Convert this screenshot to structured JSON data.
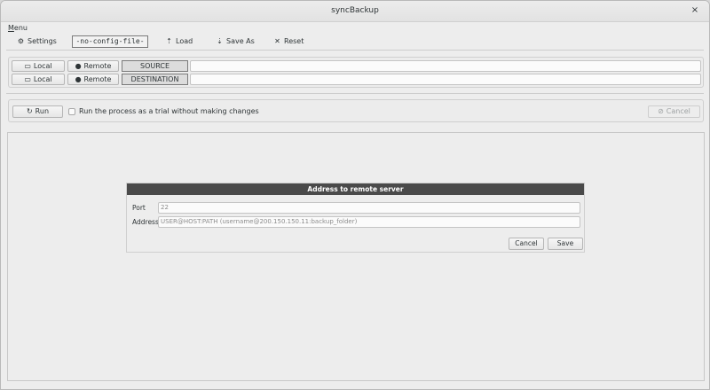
{
  "window": {
    "title": "syncBackup",
    "close_glyph": "×"
  },
  "menubar": {
    "menu_underlined": "M",
    "menu_rest": "enu"
  },
  "toolbar": {
    "settings": {
      "label": "Settings",
      "icon": "gear-icon",
      "glyph": "⚙"
    },
    "config_name": "-no-config-file-",
    "load": {
      "label": "Load",
      "icon": "upload-icon",
      "glyph": "⇡"
    },
    "save_as": {
      "label": "Save As",
      "icon": "download-icon",
      "glyph": "⇣"
    },
    "reset": {
      "label": "Reset",
      "icon": "close-icon",
      "glyph": "✕"
    }
  },
  "paths": {
    "source": {
      "local_label": "Local",
      "remote_label": "Remote",
      "role_label": "SOURCE",
      "path_value": ""
    },
    "destination": {
      "local_label": "Local",
      "remote_label": "Remote",
      "role_label": "DESTINATION",
      "path_value": ""
    },
    "local_icon": {
      "name": "folder-icon",
      "glyph": "▭"
    },
    "remote_icon": {
      "name": "globe-icon",
      "glyph": "●"
    }
  },
  "run": {
    "run_label": "Run",
    "run_icon": {
      "name": "refresh-icon",
      "glyph": "↻"
    },
    "dry_run_label": "Run the process as a trial without making changes",
    "dry_run_checked": false,
    "cancel_label": "Cancel",
    "cancel_icon": {
      "name": "cancel-icon",
      "glyph": "⊘"
    },
    "cancel_enabled": false
  },
  "dialog": {
    "title": "Address to remote server",
    "port_label": "Port",
    "port_placeholder": "22",
    "address_label": "Address",
    "address_placeholder": "USER@HOST:PATH (username@200.150.150.11:backup_folder)",
    "cancel_label": "Cancel",
    "save_label": "Save"
  },
  "colors": {
    "dialog_header_bg": "#4a4a4a",
    "window_bg": "#ededed"
  }
}
